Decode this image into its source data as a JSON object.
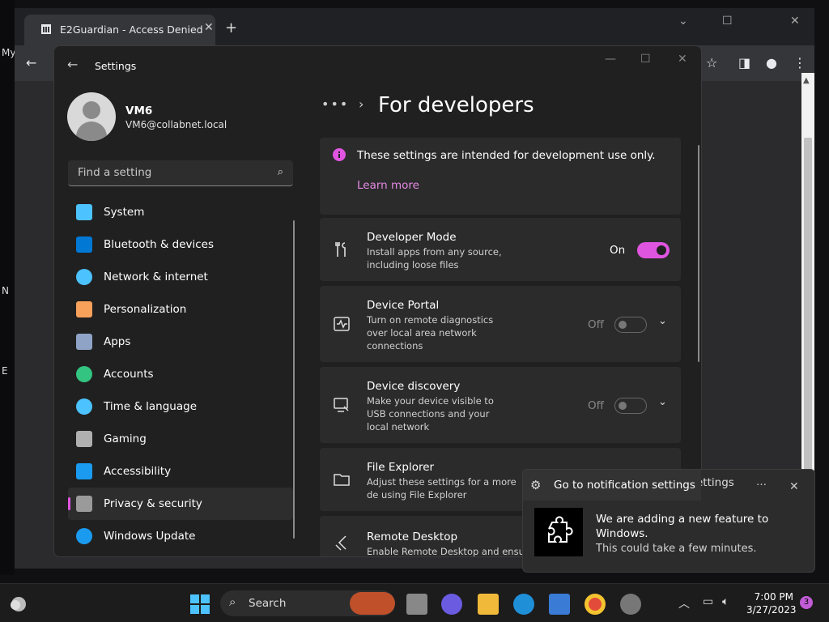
{
  "desktop": {
    "left_labels": [
      "My",
      "N",
      "E"
    ]
  },
  "browser": {
    "tab_title": "E2Guardian - Access Denied",
    "tab_close": "✕",
    "new_tab": "+",
    "win_min": "⌄",
    "win_restore": "☐",
    "win_close": "✕",
    "back": "←"
  },
  "settings": {
    "title": "Settings",
    "back": "←",
    "user": {
      "name": "VM6",
      "email": "VM6@collabnet.local"
    },
    "search_placeholder": "Find a setting",
    "nav": [
      {
        "label": "System",
        "icon": "monitor-icon",
        "color": "#4cc2ff"
      },
      {
        "label": "Bluetooth & devices",
        "icon": "bluetooth-icon",
        "color": "#0078d4"
      },
      {
        "label": "Network & internet",
        "icon": "wifi-icon",
        "color": "#4cc2ff"
      },
      {
        "label": "Personalization",
        "icon": "brush-icon",
        "color": "#f7a15a"
      },
      {
        "label": "Apps",
        "icon": "apps-icon",
        "color": "#8fa3c6"
      },
      {
        "label": "Accounts",
        "icon": "person-icon",
        "color": "#33c481"
      },
      {
        "label": "Time & language",
        "icon": "globe-clock-icon",
        "color": "#4cc2ff"
      },
      {
        "label": "Gaming",
        "icon": "gamepad-icon",
        "color": "#b0b0b0"
      },
      {
        "label": "Accessibility",
        "icon": "accessibility-icon",
        "color": "#1a9bf0"
      },
      {
        "label": "Privacy & security",
        "icon": "shield-icon",
        "color": "#9a9a9a"
      },
      {
        "label": "Windows Update",
        "icon": "update-icon",
        "color": "#1a9bf0"
      }
    ],
    "active_index": 9,
    "crumb_dots": "•••",
    "crumb_chev": "›",
    "page_title": "For developers",
    "info": {
      "text": "These settings are intended for development use only.",
      "link": "Learn more"
    },
    "cards": [
      {
        "title": "Developer Mode",
        "desc": "Install apps from any source, including loose files",
        "state": "On"
      },
      {
        "title": "Device Portal",
        "desc": "Turn on remote diagnostics over local area network connections",
        "state": "Off"
      },
      {
        "title": "Device discovery",
        "desc": "Make your device visible to USB connections and your local network",
        "state": "Off"
      },
      {
        "title": "File Explorer",
        "desc": "Adjust these settings for a more de using File Explorer"
      },
      {
        "title": "Remote Desktop",
        "desc": "Enable Remote Desktop and ensure"
      }
    ],
    "chevron": "⌄"
  },
  "notification": {
    "header": "Go to notification settings",
    "header_overlap": "ettings",
    "dots": "…",
    "close": "✕",
    "message": "We are adding a new feature to Windows.",
    "sub": "This could take a few minutes."
  },
  "taskbar": {
    "search_label": "Search",
    "time": "7:00 PM",
    "date": "3/27/2023",
    "badge": "3",
    "accent": "#0078d4"
  }
}
